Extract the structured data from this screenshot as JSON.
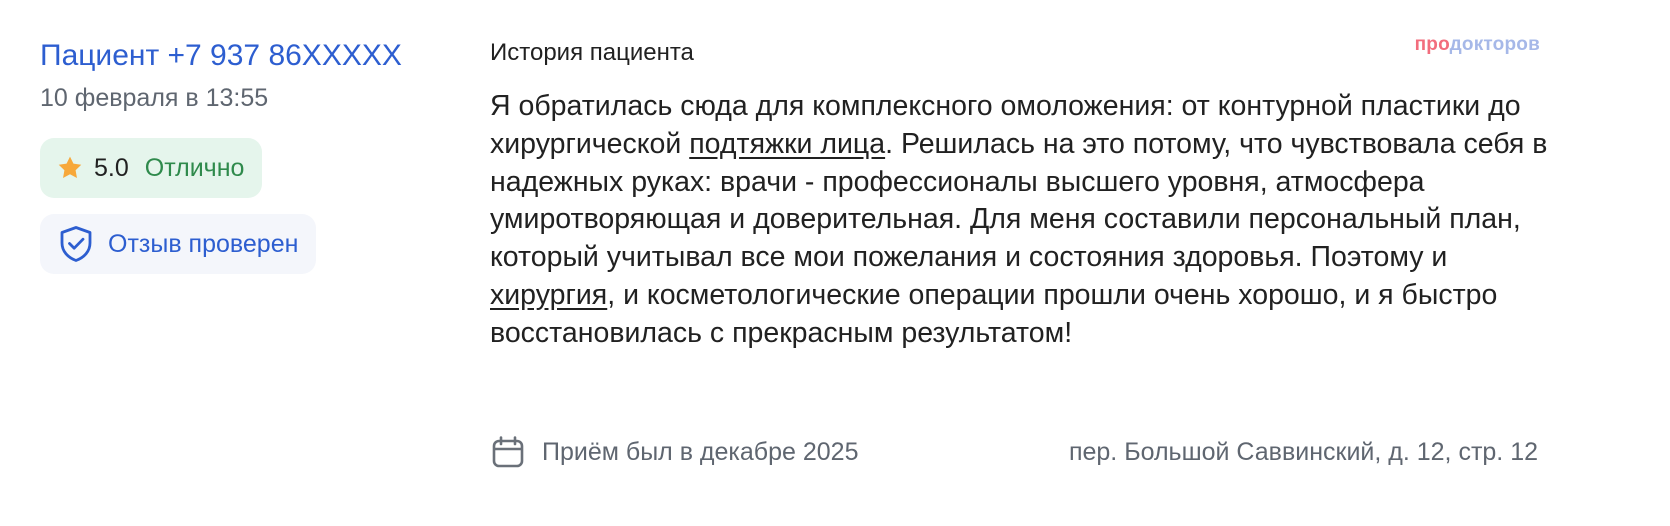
{
  "patient": {
    "name": "Пациент +7 937 86XXXXX",
    "date": "10 февраля в 13:55"
  },
  "rating": {
    "icon": "star-icon",
    "value": "5.0",
    "label": "Отлично",
    "star_color": "#f7a83a"
  },
  "verified": {
    "icon": "shield-check-icon",
    "label": "Отзыв проверен"
  },
  "review": {
    "title": "История пациента",
    "text_part1": "Я обратилась сюда для комплексного омоложения: от контурной пластики до хирургической ",
    "link1": "подтяжки лица",
    "text_part2": ". Решилась на это потому, что чувствовала себя в надежных руках: врачи - профессионалы высшего уровня, атмосфера умиротворяющая и доверительная. Для меня составили персональный план, который учитывал все мои пожелания и состояния здоровья. Поэтому и ",
    "link2": "хирургия",
    "text_part3": ", и косметологические операции прошли очень хорошо, и я быстро восстановилась с прекрасным результатом!"
  },
  "brand": {
    "part1": "про",
    "part2": "докторов"
  },
  "footer": {
    "icon": "calendar-icon",
    "visit": "Приём был в декабре 2025",
    "address": "пер. Большой Саввинский, д. 12, стр. 12"
  },
  "colors": {
    "accent_blue": "#2d5ed0",
    "rating_bg": "#e5f5ec",
    "rating_green": "#2f8a4c",
    "verified_bg": "#f4f6fb",
    "brand_pink": "#f26d7d",
    "brand_blue": "#a6b8e8"
  }
}
